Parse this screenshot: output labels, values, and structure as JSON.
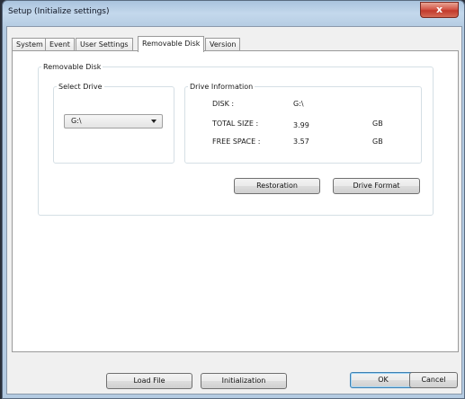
{
  "window": {
    "title": "Setup (Initialize settings)",
    "close_glyph": "x"
  },
  "tabs": [
    {
      "label": "System"
    },
    {
      "label": "Event"
    },
    {
      "label": "User Settings"
    },
    {
      "label": "Removable Disk"
    },
    {
      "label": "Version"
    }
  ],
  "active_tab": "Removable Disk",
  "removable_disk": {
    "group_label": "Removable Disk",
    "select_drive": {
      "group_label": "Select Drive",
      "selected": "G:\\"
    },
    "drive_info": {
      "group_label": "Drive Information",
      "disk_label": "DISK :",
      "disk_value": "G:\\",
      "total_label": "TOTAL SIZE :",
      "total_value": "3.99",
      "total_unit": "GB",
      "free_label": "FREE SPACE :",
      "free_value": "3.57",
      "free_unit": "GB"
    },
    "restoration_label": "Restoration",
    "drive_format_label": "Drive Format"
  },
  "footer": {
    "load_file_label": "Load File",
    "initialization_label": "Initialization",
    "ok_label": "OK",
    "cancel_label": "Cancel"
  }
}
